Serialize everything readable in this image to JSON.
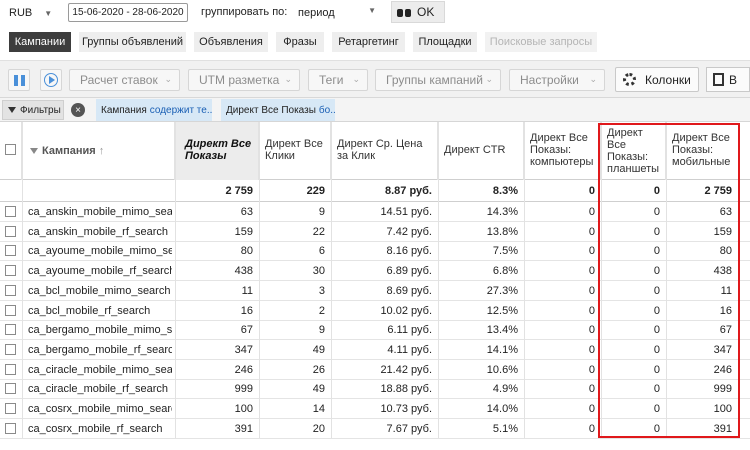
{
  "top": {
    "currency": "RUB",
    "date_range": "15-06-2020 - 28-06-2020",
    "group_label": "группировать по:",
    "group_value": "период",
    "ok_label": "OK"
  },
  "tabs": [
    {
      "label": "Кампании"
    },
    {
      "label": "Группы объявлений"
    },
    {
      "label": "Объявления"
    },
    {
      "label": "Фразы"
    },
    {
      "label": "Ретаргетинг"
    },
    {
      "label": "Площадки"
    },
    {
      "label": "Поисковые запросы"
    }
  ],
  "toolbar": {
    "bid_calc": "Расчет ставок",
    "utm": "UTM разметка",
    "tags": "Теги",
    "campaign_groups": "Группы кампаний",
    "settings": "Настройки",
    "columns": "Колонки",
    "extra": "В"
  },
  "filters": {
    "label": "Фильтры",
    "clear": "×",
    "chip1_field": "Кампания",
    "chip1_op": "содержит те...",
    "chip2_field": "Директ Все Показы",
    "chip2_op": "бо..."
  },
  "table": {
    "headers": {
      "campaign": "Кампания",
      "impressions": "Директ Все Показы",
      "clicks": "Директ Все Клики",
      "cpc": "Директ Ср. Цена за Клик",
      "ctr": "Директ CTR",
      "desktop": "Директ Все Показы: компьютеры",
      "tablet": "Директ Все Показы: планшеты",
      "mobile": "Директ Все Показы: мобильные"
    },
    "total": {
      "impressions": "2 759",
      "clicks": "229",
      "cpc": "8.87 руб.",
      "ctr": "8.3%",
      "desktop": "0",
      "tablet": "0",
      "mobile": "2 759"
    },
    "rows": [
      {
        "name": "ca_anskin_mobile_mimo_search",
        "impressions": "63",
        "clicks": "9",
        "cpc": "14.51 руб.",
        "ctr": "14.3%",
        "desktop": "0",
        "tablet": "0",
        "mobile": "63"
      },
      {
        "name": "ca_anskin_mobile_rf_search",
        "impressions": "159",
        "clicks": "22",
        "cpc": "7.42 руб.",
        "ctr": "13.8%",
        "desktop": "0",
        "tablet": "0",
        "mobile": "159"
      },
      {
        "name": "ca_ayoume_mobile_mimo_search",
        "impressions": "80",
        "clicks": "6",
        "cpc": "8.16 руб.",
        "ctr": "7.5%",
        "desktop": "0",
        "tablet": "0",
        "mobile": "80"
      },
      {
        "name": "ca_ayoume_mobile_rf_search",
        "impressions": "438",
        "clicks": "30",
        "cpc": "6.89 руб.",
        "ctr": "6.8%",
        "desktop": "0",
        "tablet": "0",
        "mobile": "438"
      },
      {
        "name": "ca_bcl_mobile_mimo_search",
        "impressions": "11",
        "clicks": "3",
        "cpc": "8.69 руб.",
        "ctr": "27.3%",
        "desktop": "0",
        "tablet": "0",
        "mobile": "11"
      },
      {
        "name": "ca_bcl_mobile_rf_search",
        "impressions": "16",
        "clicks": "2",
        "cpc": "10.02 руб.",
        "ctr": "12.5%",
        "desktop": "0",
        "tablet": "0",
        "mobile": "16"
      },
      {
        "name": "ca_bergamo_mobile_mimo_search",
        "impressions": "67",
        "clicks": "9",
        "cpc": "6.11 руб.",
        "ctr": "13.4%",
        "desktop": "0",
        "tablet": "0",
        "mobile": "67"
      },
      {
        "name": "ca_bergamo_mobile_rf_search",
        "impressions": "347",
        "clicks": "49",
        "cpc": "4.11 руб.",
        "ctr": "14.1%",
        "desktop": "0",
        "tablet": "0",
        "mobile": "347"
      },
      {
        "name": "ca_ciracle_mobile_mimo_search",
        "impressions": "246",
        "clicks": "26",
        "cpc": "21.42 руб.",
        "ctr": "10.6%",
        "desktop": "0",
        "tablet": "0",
        "mobile": "246"
      },
      {
        "name": "ca_ciracle_mobile_rf_search",
        "impressions": "999",
        "clicks": "49",
        "cpc": "18.88 руб.",
        "ctr": "4.9%",
        "desktop": "0",
        "tablet": "0",
        "mobile": "999"
      },
      {
        "name": "ca_cosrx_mobile_mimo_search",
        "impressions": "100",
        "clicks": "14",
        "cpc": "10.73 руб.",
        "ctr": "14.0%",
        "desktop": "0",
        "tablet": "0",
        "mobile": "100"
      },
      {
        "name": "ca_cosrx_mobile_rf_search",
        "impressions": "391",
        "clicks": "20",
        "cpc": "7.67 руб.",
        "ctr": "5.1%",
        "desktop": "0",
        "tablet": "0",
        "mobile": "391"
      }
    ]
  },
  "colors": {
    "active_tab": "#3d3d3d",
    "chip_bg": "#d7e8f6",
    "highlight": "#e0181b",
    "accent": "#4a90d9"
  }
}
